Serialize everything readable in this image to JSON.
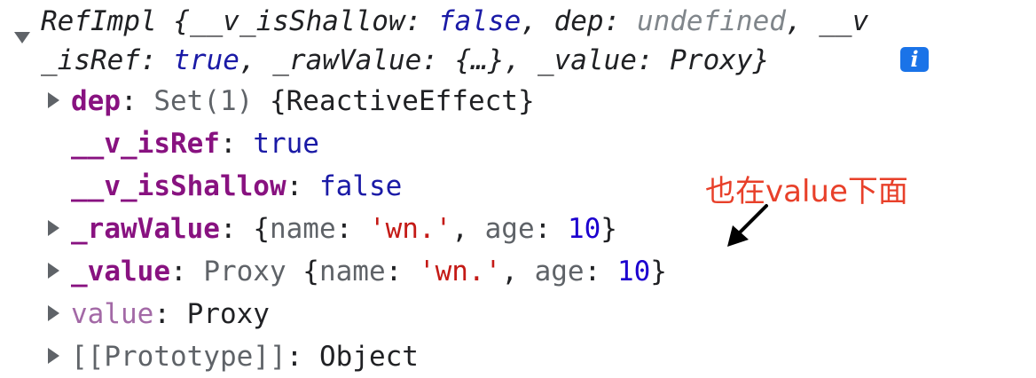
{
  "summary": {
    "class_name": "RefImpl",
    "open_brace": " {",
    "p1_key": "__v_isShallow",
    "p1_sep": ": ",
    "p1_val": "false",
    "comma1": ", ",
    "p2_key": "dep",
    "p2_sep": ": ",
    "p2_val": "undefined",
    "comma2": ", ",
    "p3_key_a": "__v",
    "p3_key_b": "_isRef",
    "p3_sep": ": ",
    "p3_val": "true",
    "comma3": ", ",
    "p4_key": "_rawValue",
    "p4_sep": ": ",
    "p4_val": "{…}",
    "comma4": ", ",
    "p5_key": "_value",
    "p5_sep": ": ",
    "p5_val": "Proxy",
    "close_brace": "}"
  },
  "info_badge": "i",
  "props": {
    "dep": {
      "key": "dep",
      "sep": ": ",
      "type": "Set(1) ",
      "value": "{ReactiveEffect}"
    },
    "is_ref": {
      "key": "__v_isRef",
      "sep": ": ",
      "value": "true"
    },
    "is_shallow": {
      "key": "__v_isShallow",
      "sep": ": ",
      "value": "false"
    },
    "raw_value": {
      "key": "_rawValue",
      "sep": ": ",
      "open": "{",
      "k1": "name",
      "s1": ": ",
      "v1": "'wn.'",
      "c1": ", ",
      "k2": "age",
      "s2": ": ",
      "v2": "10",
      "close": "}"
    },
    "value_internal": {
      "key": "_value",
      "sep": ": ",
      "type": "Proxy ",
      "open": "{",
      "k1": "name",
      "s1": ": ",
      "v1": "'wn.'",
      "c1": ", ",
      "k2": "age",
      "s2": ": ",
      "v2": "10",
      "close": "}"
    },
    "value_getter": {
      "key": "value",
      "sep": ": ",
      "value": "Proxy"
    },
    "prototype": {
      "key": "[[Prototype]]",
      "sep": ": ",
      "value": "Object"
    }
  },
  "annotation": {
    "text": "也在value下面",
    "color": "#e8402a"
  },
  "colors": {
    "key_bold": "#881280",
    "key_dim": "#a369a6",
    "boolean": "#1a1aa6",
    "number": "#1c00cf",
    "string": "#c41a16",
    "info_badge": "#1a73e8"
  }
}
